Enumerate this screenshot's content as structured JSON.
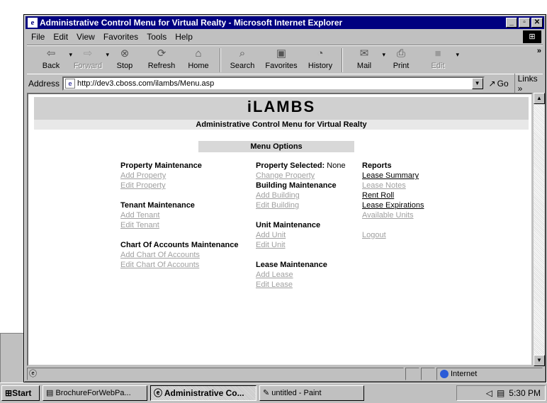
{
  "window": {
    "title": "Administrative Control Menu for Virtual Realty - Microsoft Internet Explorer",
    "controls": [
      "_",
      "▫",
      "✕"
    ]
  },
  "menubar": [
    "File",
    "Edit",
    "View",
    "Favorites",
    "Tools",
    "Help"
  ],
  "toolbar": {
    "buttons": [
      {
        "label": "Back",
        "icon": "back-arrow-icon"
      },
      {
        "label": "Forward",
        "icon": "forward-arrow-icon"
      },
      {
        "label": "Stop",
        "icon": "stop-icon"
      },
      {
        "label": "Refresh",
        "icon": "refresh-icon"
      },
      {
        "label": "Home",
        "icon": "home-icon"
      },
      {
        "label": "Search",
        "icon": "search-icon"
      },
      {
        "label": "Favorites",
        "icon": "favorites-icon"
      },
      {
        "label": "History",
        "icon": "history-icon"
      },
      {
        "label": "Mail",
        "icon": "mail-icon"
      },
      {
        "label": "Print",
        "icon": "print-icon"
      },
      {
        "label": "Edit",
        "icon": "edit-icon"
      }
    ],
    "more": "»"
  },
  "address": {
    "label": "Address",
    "url": "http://dev3.cboss.com/ilambs/Menu.asp",
    "go_label": "Go",
    "links_label": "Links »"
  },
  "page": {
    "logo": "iLAMBS",
    "subtitle": "Administrative Control Menu for Virtual Realty",
    "menu_options": "Menu Options",
    "col1": [
      {
        "heading": "Property Maintenance",
        "links": [
          "Add Property",
          "Edit Property"
        ]
      },
      {
        "heading": "Tenant Maintenance",
        "links": [
          "Add Tenant",
          "Edit Tenant"
        ]
      },
      {
        "heading": "Chart Of Accounts Maintenance",
        "links": [
          "Add Chart Of Accounts",
          "Edit Chart Of Accounts"
        ]
      }
    ],
    "col2": {
      "property_selected_label": "Property Selected:",
      "property_selected_value": "None",
      "change_property": "Change Property",
      "sections": [
        {
          "heading": "Building Maintenance",
          "links": [
            "Add Building",
            "Edit Building"
          ]
        },
        {
          "heading": "Unit Maintenance",
          "links": [
            "Add Unit",
            "Edit Unit"
          ]
        },
        {
          "heading": "Lease Maintenance",
          "links": [
            "Add Lease",
            "Edit Lease"
          ]
        }
      ]
    },
    "col3": {
      "heading": "Reports",
      "links": [
        "Lease Summary",
        "Lease Notes",
        "Rent Roll",
        "Lease Expirations",
        "Available Units"
      ],
      "logout": "Logout"
    }
  },
  "status": {
    "zone": "Internet"
  },
  "taskbar": {
    "start": "Start",
    "tasks": [
      "BrochureForWebPa...",
      "Administrative Co...",
      "untitled - Paint"
    ],
    "clock": "5:30 PM"
  },
  "colors": {
    "titlebar": "#000080",
    "link_unvisited": "#a0a0a0",
    "header_band": "#d0d0d0"
  }
}
